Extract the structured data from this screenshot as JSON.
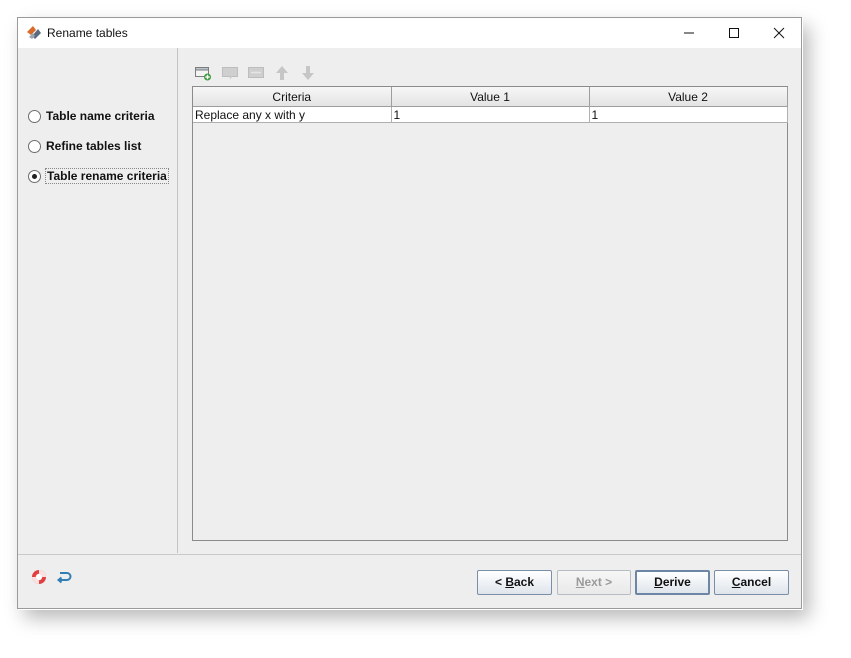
{
  "window": {
    "title": "Rename tables",
    "app_icon": "app-logo-icon",
    "controls": [
      "minimize-icon",
      "maximize-icon",
      "close-icon"
    ]
  },
  "steps": [
    {
      "label": "Table name criteria",
      "selected": false
    },
    {
      "label": "Refine tables list",
      "selected": false
    },
    {
      "label": "Table rename criteria",
      "selected": true
    }
  ],
  "toolbar": {
    "icons": [
      "add-row-icon",
      "edit-row-icon",
      "delete-row-icon",
      "move-up-icon",
      "move-down-icon"
    ]
  },
  "table": {
    "columns": [
      "Criteria",
      "Value 1",
      "Value 2"
    ],
    "rows": [
      [
        "Replace any x with y",
        "1",
        "1"
      ]
    ]
  },
  "footer": {
    "icons": [
      "help-lifebuoy-icon",
      "reset-icon"
    ],
    "back_label": {
      "pre": "< ",
      "mnemonic": "B",
      "post": "ack"
    },
    "next_label": {
      "pre": "",
      "mnemonic": "N",
      "post": "ext >"
    },
    "derive_label": {
      "pre": "",
      "mnemonic": "D",
      "post": "erive"
    },
    "cancel_label": {
      "pre": "",
      "mnemonic": "C",
      "post": "ancel"
    }
  },
  "colors": {
    "dialog_bg": "#eeeeee",
    "button_border": "#7a8ea8",
    "disabled_text": "#9a9a9a"
  }
}
